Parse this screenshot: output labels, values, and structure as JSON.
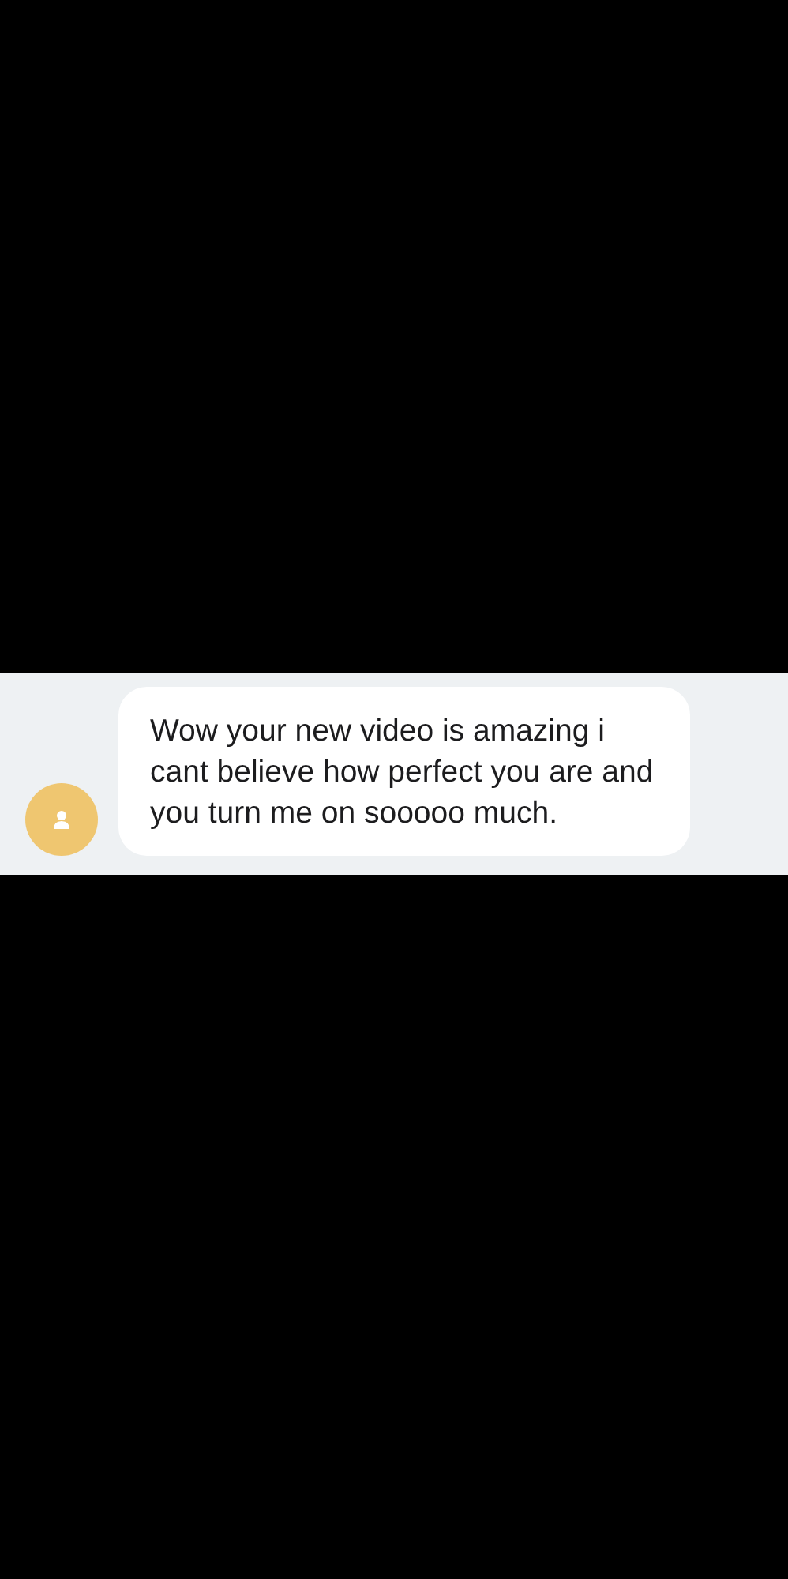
{
  "messages": [
    {
      "kind": "incoming",
      "text": "Wow your new video is amazing i cant believe how perfect you are and you turn me on sooooo much."
    }
  ]
}
